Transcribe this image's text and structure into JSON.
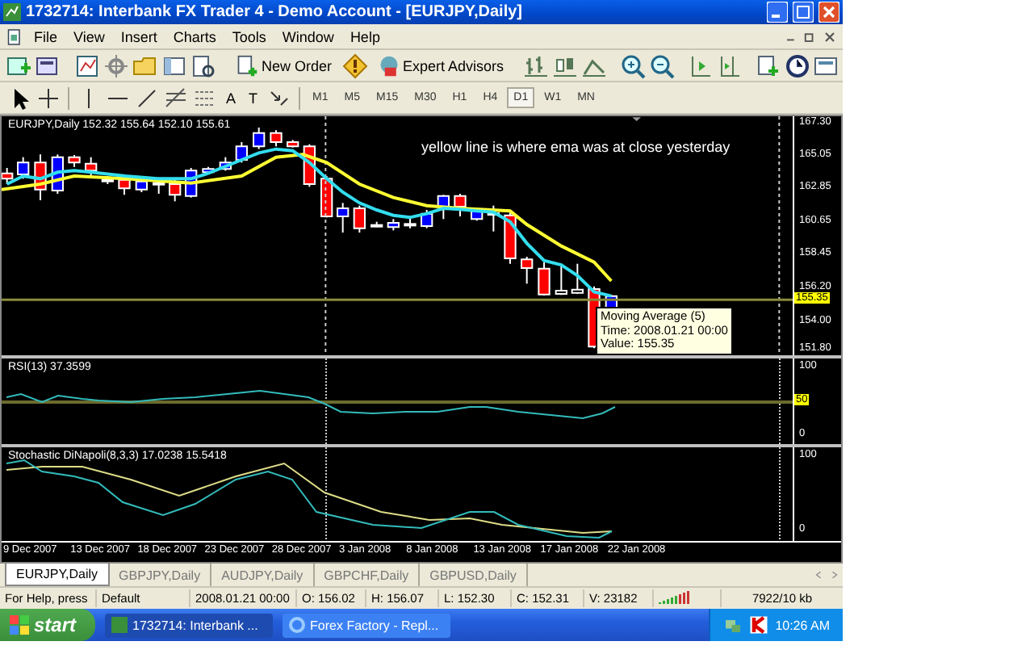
{
  "window": {
    "title": "1732714: Interbank FX Trader 4 - Demo Account - [EURJPY,Daily]"
  },
  "menu": [
    "File",
    "View",
    "Insert",
    "Charts",
    "Tools",
    "Window",
    "Help"
  ],
  "toolbar": {
    "buttons": [
      "New Order",
      "Expert Advisors"
    ]
  },
  "drawing_tools": [
    "A",
    "T"
  ],
  "timeframes": [
    {
      "label": "M1",
      "selected": false
    },
    {
      "label": "M5",
      "selected": false
    },
    {
      "label": "M15",
      "selected": false
    },
    {
      "label": "M30",
      "selected": false
    },
    {
      "label": "H1",
      "selected": false
    },
    {
      "label": "H4",
      "selected": false
    },
    {
      "label": "D1",
      "selected": true
    },
    {
      "label": "W1",
      "selected": false
    },
    {
      "label": "MN",
      "selected": false
    }
  ],
  "chart": {
    "header": "EURJPY,Daily  152.32 155.64 152.10 155.61",
    "note": "yellow line is where ema was at close yesterday",
    "price_ticks": [
      "167.30",
      "165.05",
      "162.85",
      "160.65",
      "158.45",
      "156.20",
      "154.00",
      "151.80"
    ],
    "current_price": "155.35",
    "tooltip": [
      "Moving Average (5)",
      "Time: 2008.01.21 00:00",
      "Value: 155.35"
    ]
  },
  "rsi": {
    "header": "RSI(13) 37.3599",
    "ticks": [
      "100",
      "0"
    ],
    "level": "50"
  },
  "stochastic": {
    "header": "Stochastic DiNapoli(8,3,3) 17.0238 15.5418",
    "ticks": [
      "100",
      "0"
    ]
  },
  "dates": [
    "9 Dec 2007",
    "13 Dec 2007",
    "18 Dec 2007",
    "23 Dec 2007",
    "28 Dec 2007",
    "3 Jan 2008",
    "8 Jan 2008",
    "13 Jan 2008",
    "17 Jan 2008",
    "22 Jan 2008"
  ],
  "chart_tabs": [
    {
      "label": "EURJPY,Daily",
      "selected": true
    },
    {
      "label": "GBPJPY,Daily",
      "selected": false
    },
    {
      "label": "AUDJPY,Daily",
      "selected": false
    },
    {
      "label": "GBPCHF,Daily",
      "selected": false
    },
    {
      "label": "GBPUSD,Daily",
      "selected": false
    }
  ],
  "status_bar": [
    "For Help, press",
    "Default",
    "2008.01.21 00:00",
    "O: 156.02",
    "H: 156.07",
    "L: 152.30",
    "C: 152.31",
    "V: 23182",
    "7922/10 kb"
  ],
  "taskbar": {
    "start": "start",
    "tasks": [
      {
        "label": "1732714: Interbank ...",
        "selected": true
      },
      {
        "label": "Forex Factory - Repl...",
        "selected": false
      }
    ],
    "clock": "10:26 AM"
  }
}
